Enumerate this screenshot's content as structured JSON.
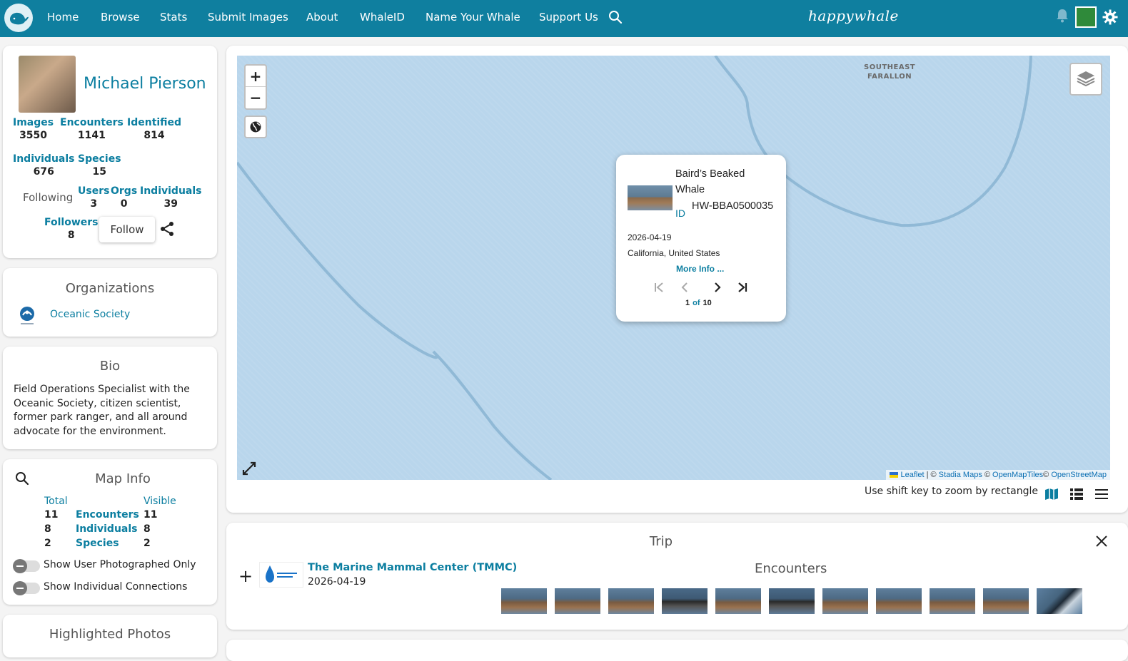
{
  "nav": {
    "items": [
      "Home",
      "Browse",
      "Stats",
      "Submit Images",
      "About",
      "WhaleID",
      "Name Your Whale",
      "Support Us"
    ],
    "brand": "happywhale",
    "accent": "#0f7f9f"
  },
  "profile": {
    "name": "Michael Pierson",
    "stats": {
      "images": {
        "label": "Images",
        "value": "3550"
      },
      "encounters": {
        "label": "Encounters",
        "value": "1141"
      },
      "identified": {
        "label": "Identified",
        "value": "814"
      },
      "individuals": {
        "label": "Individuals",
        "value": "676"
      },
      "species": {
        "label": "Species",
        "value": "15"
      },
      "following_users": {
        "label": "Users",
        "value": "3"
      },
      "following_orgs": {
        "label": "Orgs",
        "value": "0"
      },
      "following_individuals": {
        "label": "Individuals",
        "value": "39"
      },
      "followers": {
        "label": "Followers",
        "value": "8"
      }
    },
    "following_label": "Following",
    "follow_button": "Follow"
  },
  "organizations": {
    "title": "Organizations",
    "items": [
      {
        "name": "Oceanic Society"
      }
    ]
  },
  "bio": {
    "title": "Bio",
    "text": "Field Operations Specialist with the Oceanic Society, citizen scientist, former park ranger, and all around advocate for the environment."
  },
  "map_info": {
    "title": "Map Info",
    "col_total": "Total",
    "col_visible": "Visible",
    "rows": [
      {
        "total": "11",
        "label": "Encounters",
        "visible": "11"
      },
      {
        "total": "8",
        "label": "Individuals",
        "visible": "8"
      },
      {
        "total": "2",
        "label": "Species",
        "visible": "2"
      }
    ],
    "toggles": [
      {
        "label": "Show User Photographed Only",
        "on": false
      },
      {
        "label": "Show Individual Connections",
        "on": false
      }
    ]
  },
  "highlighted": {
    "title": "Highlighted Photos"
  },
  "map": {
    "place_label_line1": "SOUTHEAST",
    "place_label_line2": "FARALLON",
    "zoom_in": "+",
    "zoom_out": "−",
    "attribution": {
      "leaflet": "Leaflet",
      "sep1": " | © ",
      "stadia": "Stadia Maps",
      "sep2": " © ",
      "omt": "OpenMapTiles",
      "sep3": "© ",
      "osm": "OpenStreetMap"
    },
    "zoom_hint": "Use shift key to zoom by rectangle",
    "popup": {
      "species": "Baird’s Beaked Whale",
      "id_label": "ID",
      "id": "HW-BBA0500035",
      "date": "2026-04-19",
      "location": "California, United States",
      "more_info": "More Info ...",
      "page_current": "1",
      "page_of": "of",
      "page_total": "10"
    }
  },
  "trip": {
    "title": "Trip",
    "org": "The Marine Mammal Center (TMMC)",
    "date": "2026-04-19",
    "encounters_title": "Encounters",
    "thumbnails": [
      "whale-photo",
      "whale-photo",
      "whale-photo",
      "whale-photo",
      "whale-photo",
      "whale-photo",
      "whale-photo",
      "whale-photo",
      "whale-photo",
      "whale-photo",
      "whale-tail-photo"
    ]
  }
}
